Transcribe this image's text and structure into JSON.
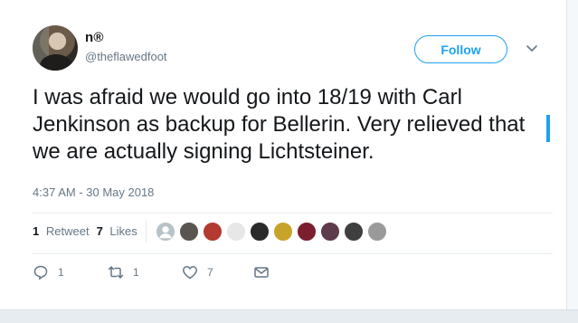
{
  "tweet": {
    "display_name": "n®",
    "handle": "@theflawedfoot",
    "follow_label": "Follow",
    "text": "I was afraid we would go into 18/19 with Carl Jenkinson as backup for Bellerin. Very relieved that we are actually signing Lichtsteiner.",
    "timestamp": "4:37 AM - 30 May 2018"
  },
  "stats": {
    "retweet_count": "1",
    "retweet_label": "Retweet",
    "like_count": "7",
    "like_label": "Likes"
  },
  "likers": [
    {
      "color": "#b8c2c9",
      "icon": "default-avatar-icon"
    },
    {
      "color": "#5a5550"
    },
    {
      "color": "#b23a2f"
    },
    {
      "color": "#e7e7e7"
    },
    {
      "color": "#2a2a2a"
    },
    {
      "color": "#c8a32a"
    },
    {
      "color": "#7b1e2e"
    },
    {
      "color": "#5e3b4a"
    },
    {
      "color": "#3f3f3f"
    },
    {
      "color": "#9a9a9a"
    }
  ],
  "actions": {
    "reply_count": "1",
    "retweet_count": "1",
    "like_count": "7"
  },
  "colors": {
    "accent": "#1da1f2",
    "text_primary": "#14171a",
    "text_secondary": "#657786",
    "border": "#e6ecf0"
  }
}
